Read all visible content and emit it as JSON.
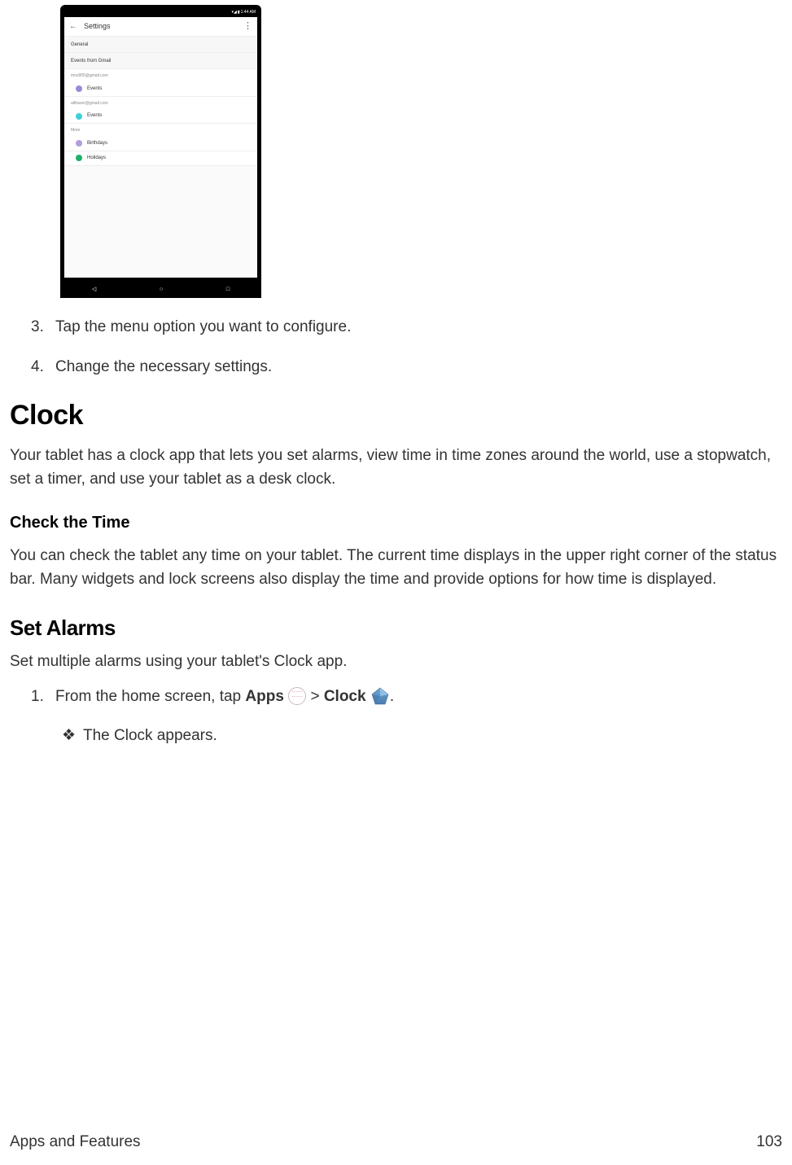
{
  "screenshot": {
    "status_time": "1:44 AM",
    "app_title": "Settings",
    "sections": {
      "general": "General",
      "events_from_gmail": "Events from Gmail",
      "acct1": "mos905@gmail.com",
      "acct1_item": "Events",
      "acct2": "althaver@gmail.com",
      "acct2_item": "Events",
      "more": "More",
      "birthdays": "Birthdays",
      "holidays": "Holidays"
    },
    "colors": {
      "purple": "#9c89d9",
      "teal": "#3dd0d8",
      "violet": "#b39ddb",
      "green": "#1eaf6a"
    }
  },
  "steps": {
    "s3_num": "3.",
    "s3": "Tap the menu option you want to configure.",
    "s4_num": "4.",
    "s4": "Change the necessary settings."
  },
  "clock": {
    "heading": "Clock",
    "intro": "Your tablet has a clock app that lets you set alarms, view time in time zones around the world, use a stopwatch, set a timer, and use your tablet as a desk clock.",
    "check_heading": "Check the Time",
    "check_body": "You can check the tablet any time on your tablet. The current time displays in the upper right corner of the status bar. Many widgets and lock screens also display the time and provide options for how time is displayed."
  },
  "alarms": {
    "heading": "Set Alarms",
    "intro": "Set multiple alarms using your tablet's Clock app.",
    "step1_num": "1.",
    "step1_pre": "From the home screen, tap ",
    "step1_apps": "Apps",
    "step1_gt": " > ",
    "step1_clock": "Clock",
    "step1_period": ".",
    "sub_bullet": "❖",
    "sub_text": "The Clock appears."
  },
  "footer": {
    "section": "Apps and Features",
    "page": "103"
  }
}
